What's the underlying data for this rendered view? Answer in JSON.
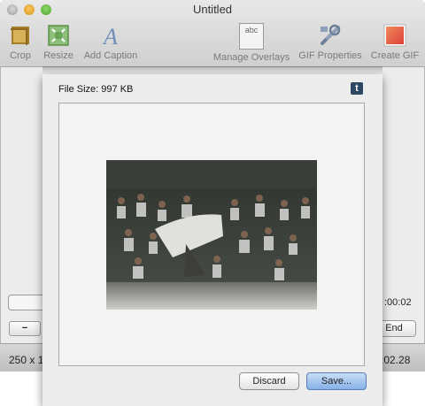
{
  "window": {
    "title": "Untitled"
  },
  "toolbar": {
    "crop_label": "Crop",
    "resize_label": "Resize",
    "caption_label": "Add Caption",
    "overlays_label": "Manage Overlays",
    "overlays_icon_text": "abc",
    "gif_properties_label": "GIF Properties",
    "create_gif_label": "Create GIF"
  },
  "editor": {
    "minus_label": "−",
    "end_label": "End",
    "time_a": ":00:02",
    "dims_text": "250 x 1",
    "time_b": ":02.28"
  },
  "sheet": {
    "file_size": "File Size: 997 KB",
    "tumblr_glyph": "t",
    "discard_label": "Discard",
    "save_label": "Save..."
  },
  "colors": {
    "accent": "#86b1e8",
    "tumblr": "#2c4762"
  }
}
